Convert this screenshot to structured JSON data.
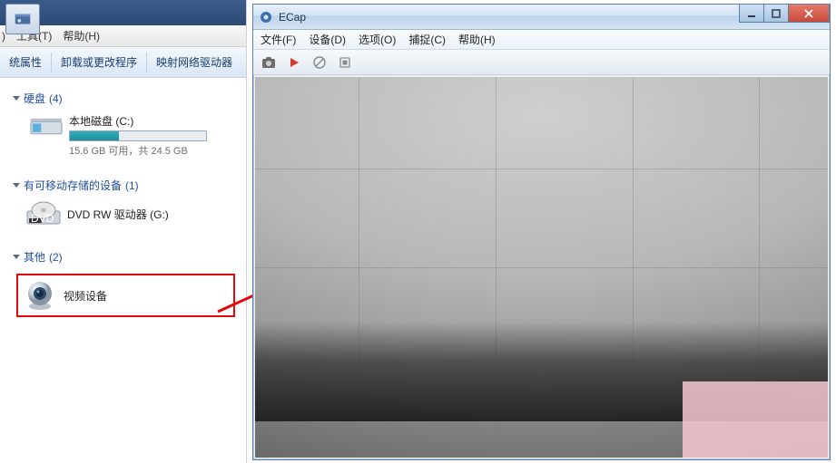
{
  "explorer": {
    "menu_partial_v": ")",
    "menu_tools": "工具(T)",
    "menu_help": "帮助(H)",
    "toolbar": {
      "sys_props": "统属性",
      "uninstall": "卸载或更改程序",
      "map_drive": "映射网络驱动器"
    },
    "sections": {
      "hdd": {
        "title": "硬盘",
        "count": "(4)"
      },
      "removable": {
        "title": "有可移动存储的设备",
        "count": "(1)"
      },
      "other": {
        "title": "其他",
        "count": "(2)"
      }
    },
    "drive": {
      "name": "本地磁盘 (C:)",
      "capacity_text": "15.6 GB 可用，共 24.5 GB"
    },
    "dvd": {
      "label": "DVD RW 驱动器 (G:)"
    },
    "video_device": {
      "label": "视频设备"
    }
  },
  "ecap": {
    "title": "ECap",
    "menu": {
      "file": "文件(F)",
      "device": "设备(D)",
      "options": "选项(O)",
      "capture": "捕捉(C)",
      "help": "帮助(H)"
    }
  }
}
